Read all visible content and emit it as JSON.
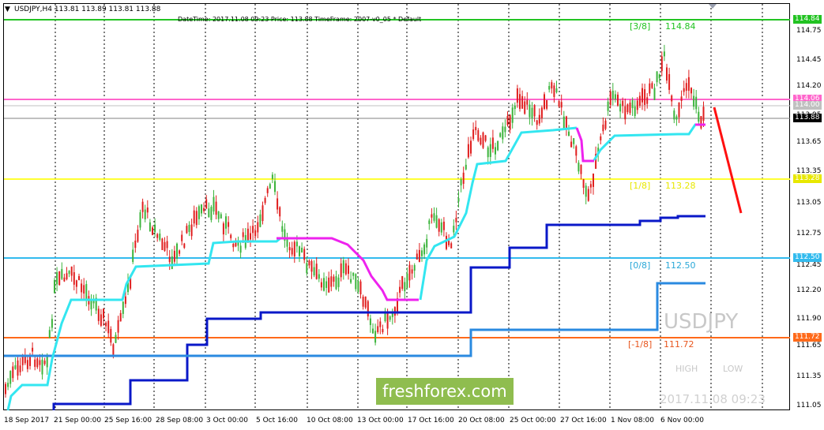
{
  "header": {
    "symbol_line": "USDJPY,H4  113.81 113.89 113.81 113.88",
    "info_line": "DateTime: 2017.11.08 09:23    Price: 113.88    TimeFrame: 2007-v0_05    *  Default"
  },
  "price_axis": [
    "114.75",
    "114.45",
    "114.20",
    "113.95",
    "113.65",
    "113.35",
    "113.05",
    "112.75",
    "112.45",
    "112.20",
    "111.90",
    "111.65",
    "111.35",
    "111.05"
  ],
  "price_tags": {
    "top_green": "114.84",
    "pink": "114.06",
    "gray": "114.00",
    "current": "113.88",
    "yellow": "113.28",
    "cyan": "112.50",
    "orange": "111.72"
  },
  "time_axis": [
    "18 Sep 2017",
    "21 Sep 00:00",
    "25 Sep 16:00",
    "28 Sep 08:00",
    "3 Oct 00:00",
    "5 Oct 16:00",
    "10 Oct 08:00",
    "13 Oct 00:00",
    "17 Oct 16:00",
    "20 Oct 08:00",
    "25 Oct 00:00",
    "27 Oct 16:00",
    "1 Nov 08:00",
    "6 Nov 00:00"
  ],
  "levels": [
    {
      "tag": "[3/8]",
      "price": "114.84",
      "color": "#22c322"
    },
    {
      "tag": "[1/8]",
      "price": "113.28",
      "color": "#e8e800"
    },
    {
      "tag": "[0/8]",
      "price": "112.50",
      "color": "#2aa8d8"
    },
    {
      "tag": "[-1/8]",
      "price": "111.72",
      "color": "#e8561e"
    }
  ],
  "symbol_label": "USDJPY",
  "high_label": "HIGH",
  "low_label": "LOW",
  "watermark": "freshforex.com",
  "datetime_stamp": "2017.11.08 09:23",
  "colors": {
    "bull": "#3cb43c",
    "bear": "#e01e1e",
    "green_line": "#22c322",
    "pink_line": "#ff66cc",
    "yellow_line": "#ffff33",
    "cyan_line": "#33bbee",
    "orange_line": "#ff6a1a",
    "aqua_trail": "#33e6f0",
    "magenta_trail": "#ee22ee",
    "navy_step": "#0a18c8",
    "blue_step": "#2a8ae0",
    "arrow": "#ff1010"
  }
}
